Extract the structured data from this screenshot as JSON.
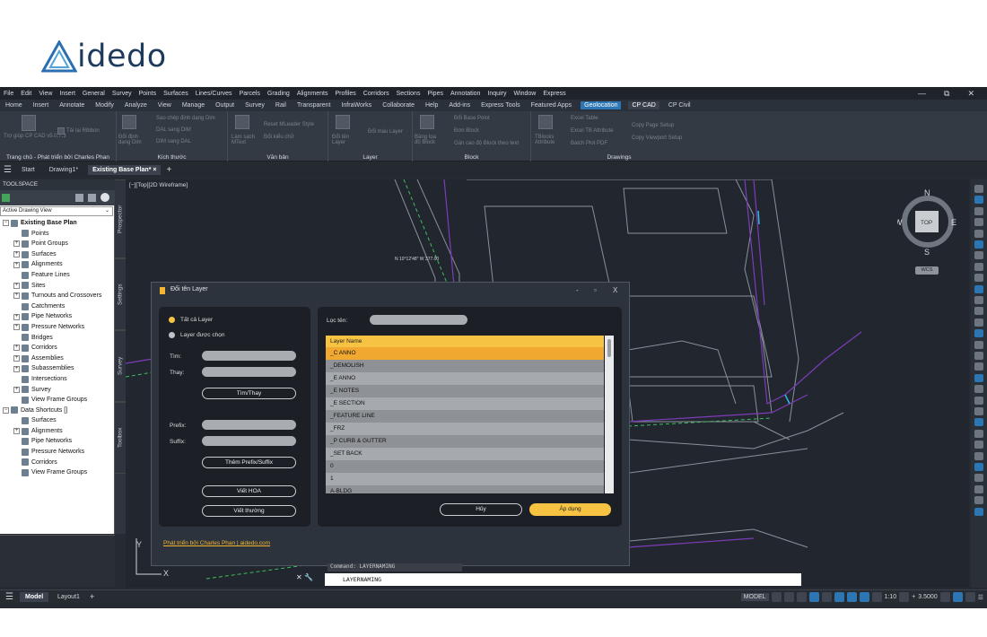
{
  "brand": {
    "logo_text": "idedo",
    "brand_color": "#2b6fb3"
  },
  "menubar": {
    "items": [
      "File",
      "Edit",
      "View",
      "Insert",
      "General",
      "Survey",
      "Points",
      "Surfaces",
      "Lines/Curves",
      "Parcels",
      "Grading",
      "Alignments",
      "Profiles",
      "Corridors",
      "Sections",
      "Pipes",
      "Annotation",
      "Inquiry",
      "Window",
      "Express"
    ]
  },
  "ribbon_tabs": {
    "items": [
      "Home",
      "Insert",
      "Annotate",
      "Modify",
      "Analyze",
      "View",
      "Manage",
      "Output",
      "Survey",
      "Rail",
      "Transparent",
      "InfraWorks",
      "Collaborate",
      "Help",
      "Add-ins",
      "Express Tools",
      "Featured Apps",
      "Geolocation",
      "CP CAD",
      "CP Civil"
    ],
    "active": "Geolocation",
    "selected": "CP CAD"
  },
  "ribbon": {
    "groups": [
      "Trang chủ - Phát triển bởi Charles Phan",
      "Kích thước",
      "Văn bản",
      "Layer",
      "Block",
      "Drawings"
    ],
    "g1": [
      "Trợ giúp CP CAD v5.0.7.3",
      "Tải lại Ribbon"
    ],
    "g2": [
      "Sao chép định dạng Dim",
      "DAL sang DIM",
      "DIM sang DAL",
      "Đổi định dạng Dim"
    ],
    "g3": [
      "Reset MLeader Style",
      "Đổi kiểu chữ",
      "Làm sạch MText"
    ],
    "g4": [
      "Đổi màu Layer",
      "Đổi tên Layer"
    ],
    "g5": [
      "Đổi Base Point",
      "Đơn Block",
      "Gán cao độ Block theo text",
      "Bảng tọa độ Block"
    ],
    "g6": [
      "Excel Table",
      "Excel TB Attribute",
      "Batch Plot PDF",
      "Copy Page Setup",
      "Copy Viewport Setup",
      "TBlocks Attribute"
    ]
  },
  "doctabs": {
    "start": "Start",
    "drawing1": "Drawing1*",
    "active": "Existing Base Plan*",
    "close": "×",
    "add": "+"
  },
  "toolspace": {
    "title": "TOOLSPACE",
    "view": "Active Drawing View",
    "tree": [
      "Existing Base Plan",
      "Points",
      "Point Groups",
      "Surfaces",
      "Alignments",
      "Feature Lines",
      "Sites",
      "Turnouts and Crossovers",
      "Catchments",
      "Pipe Networks",
      "Pressure Networks",
      "Bridges",
      "Corridors",
      "Assemblies",
      "Subassemblies",
      "Intersections",
      "Survey",
      "View Frame Groups",
      "Data Shortcuts []",
      "Surfaces",
      "Alignments",
      "Pipe Networks",
      "Pressure Networks",
      "Corridors",
      "View Frame Groups"
    ],
    "sidetabs": [
      "Prospector",
      "Settings",
      "Survey",
      "Toolbox"
    ]
  },
  "viewport": {
    "label": "[−][Top][2D Wireframe]",
    "cube_top": "TOP",
    "wcs": "WCS",
    "n": "N",
    "s": "S",
    "e": "E",
    "w": "W",
    "road_label": "N 10°12'48\" W 377.00",
    "ucs_y": "Y",
    "ucs_x": "X"
  },
  "dialog": {
    "title": "Đổi tên Layer",
    "min": "-",
    "max": "▫",
    "close": "X",
    "radio_all": "Tất cả Layer",
    "radio_sel": "Layer được chọn",
    "find": "Tìm:",
    "replace": "Thay:",
    "find_btn": "Tìm/Thay",
    "prefix": "Prefix:",
    "suffix": "Suffix:",
    "add_btn": "Thêm Prefix/Suffix",
    "upper_btn": "Viết HOA",
    "lower_btn": "Viết thường",
    "filter": "Lọc tên:",
    "list_header": "Layer Name",
    "layers": [
      "_C ANNO",
      "_DEMOLISH",
      "_E ANNO",
      "_E NOTES",
      "_E SECTION",
      "_FEATURE LINE",
      "_FRZ",
      "_P CURB & GUTTER",
      "_SET BACK",
      "0",
      "1",
      "A-BLDG"
    ],
    "cancel": "Hủy",
    "apply": "Áp dụng",
    "dev": "Phát triển bởi Charles Phan | aidedo.com"
  },
  "command": {
    "history": "Command: LAYERNAMING",
    "current": "LAYERNAMING"
  },
  "status": {
    "model": "Model",
    "layout1": "Layout1",
    "add": "+",
    "mode": "MODEL",
    "scale": "1:10",
    "lineweight": "3.5000"
  },
  "colors": {
    "accent": "#f6c343",
    "cad_bg": "#22272f",
    "ribbon_active": "#2c76b4"
  }
}
